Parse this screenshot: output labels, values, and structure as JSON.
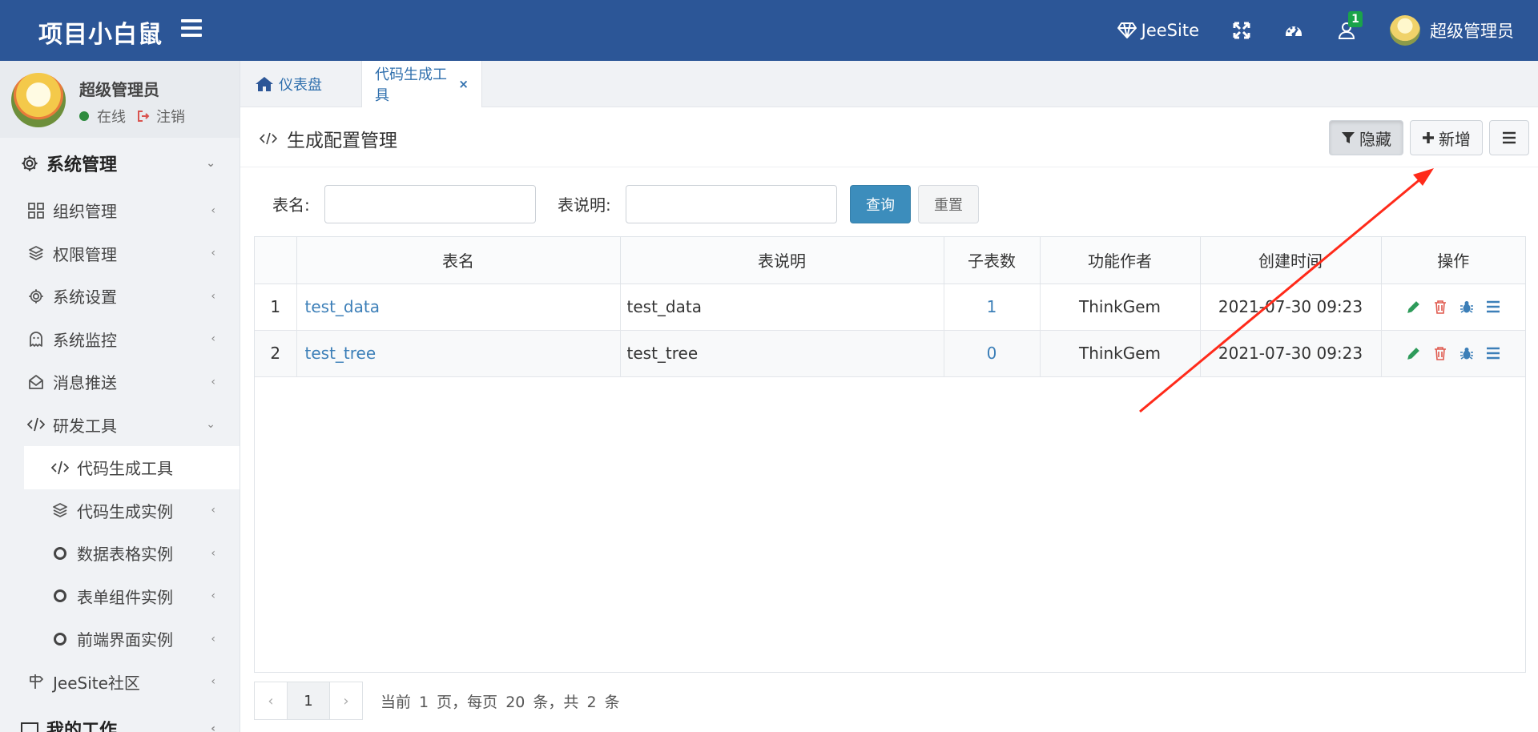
{
  "app": {
    "brand": "项目小白鼠",
    "menu_toggle": "menu-toggle",
    "top_links": [
      {
        "icon": "diamond-icon",
        "label": "JeeSite"
      },
      {
        "icon": "fullscreen-icon",
        "label": ""
      },
      {
        "icon": "dashboard-icon",
        "label": ""
      },
      {
        "icon": "user-bell-icon",
        "label": "",
        "badge": "1"
      }
    ],
    "user_label": "超级管理员"
  },
  "user_panel": {
    "name": "超级管理员",
    "status": "在线",
    "logout": "注销"
  },
  "sidebar": {
    "section_title": "系统管理",
    "items": [
      {
        "label": "组织管理",
        "icon": "grid-icon"
      },
      {
        "label": "权限管理",
        "icon": "layers-icon"
      },
      {
        "label": "系统设置",
        "icon": "gear-icon"
      },
      {
        "label": "系统监控",
        "icon": "ghost-icon"
      },
      {
        "label": "消息推送",
        "icon": "envelope-icon"
      },
      {
        "label": "研发工具",
        "icon": "code-icon"
      },
      {
        "label": "代码生成工具",
        "icon": "code-icon"
      },
      {
        "label": "代码生成实例",
        "icon": "layers-icon"
      },
      {
        "label": "数据表格实例",
        "icon": "circle-icon"
      },
      {
        "label": "表单组件实例",
        "icon": "circle-icon"
      },
      {
        "label": "前端界面实例",
        "icon": "circle-icon"
      },
      {
        "label": "JeeSite社区",
        "icon": "signpost-icon"
      },
      {
        "label": "我的工作",
        "icon": "folder-icon"
      }
    ]
  },
  "tabs": [
    {
      "label": "仪表盘",
      "icon": "home-icon"
    },
    {
      "label": "代码生成工具",
      "close": "×"
    }
  ],
  "page": {
    "title": "生成配置管理",
    "buttons": {
      "hide": "隐藏",
      "add": "新增"
    }
  },
  "search": {
    "table_name_label": "表名:",
    "table_desc_label": "表说明:",
    "table_name_value": "",
    "table_desc_value": "",
    "query": "查询",
    "reset": "重置"
  },
  "table": {
    "headers": [
      "",
      "表名",
      "表说明",
      "子表数",
      "功能作者",
      "创建时间",
      "操作"
    ],
    "rows": [
      {
        "idx": "1",
        "name": "test_data",
        "desc": "test_data",
        "sub": "1",
        "author": "ThinkGem",
        "time": "2021-07-30 09:23"
      },
      {
        "idx": "2",
        "name": "test_tree",
        "desc": "test_tree",
        "sub": "0",
        "author": "ThinkGem",
        "time": "2021-07-30 09:23"
      }
    ]
  },
  "pager": {
    "prev": "‹",
    "page": "1",
    "next": "›",
    "info": "当前 1 页，每页 20 条，共 2 条"
  },
  "colors": {
    "topbar": "#2c5697",
    "primary": "#3c8dbc",
    "link": "#3c7fb8",
    "edit": "#2e9b5a",
    "delete": "#e05a4f",
    "debug": "#3c7fb8",
    "annotation_arrow": "#ff2a1a"
  }
}
